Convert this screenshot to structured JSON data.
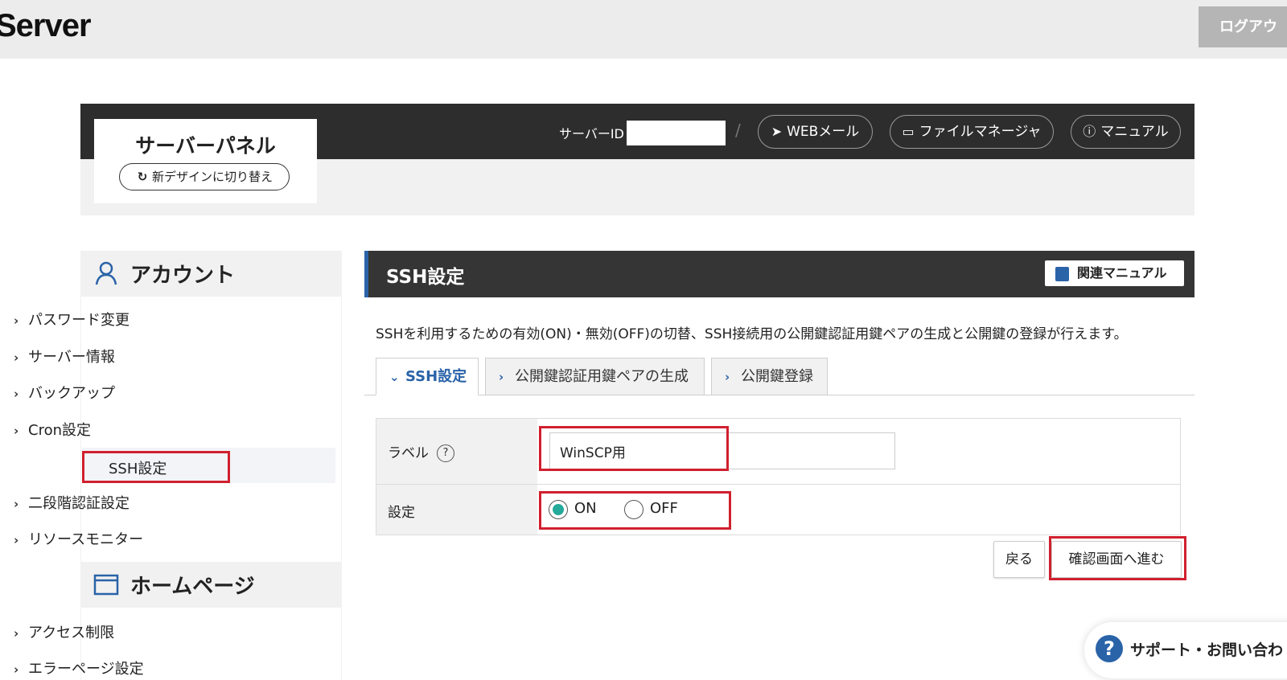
{
  "topbar": {
    "brand": "Server",
    "logout_label": "ログアウ"
  },
  "header": {
    "panel_title": "サーバーパネル",
    "design_switch_label": "新デザインに切り替え",
    "server_id_label": "サーバーID",
    "separator": "/",
    "webmail_label": "WEBメール",
    "filemanager_label": "ファイルマネージャ",
    "manual_label": "マニュアル"
  },
  "sidebar": {
    "account_title": "アカウント",
    "account_items": [
      "パスワード変更",
      "サーバー情報",
      "バックアップ",
      "Cron設定",
      "SSH設定",
      "二段階認証設定",
      "リソースモニター"
    ],
    "homepage_title": "ホームページ",
    "homepage_items": [
      "アクセス制限",
      "エラーページ設定"
    ]
  },
  "main": {
    "title": "SSH設定",
    "related_manual_label": "関連マニュアル",
    "description": "SSHを利用するための有効(ON)・無効(OFF)の切替、SSH接続用の公開鍵認証用鍵ペアの生成と公開鍵の登録が行えます。",
    "tabs": [
      {
        "label": "SSH設定",
        "active": true
      },
      {
        "label": "公開鍵認証用鍵ペアの生成",
        "active": false
      },
      {
        "label": "公開鍵登録",
        "active": false
      }
    ],
    "form": {
      "label_field_label": "ラベル",
      "help_glyph": "?",
      "label_value": "WinSCP用",
      "setting_label": "設定",
      "on_label": "ON",
      "off_label": "OFF",
      "selected": "ON"
    },
    "back_label": "戻る",
    "next_label": "確認画面へ進む"
  },
  "support": {
    "glyph": "?",
    "label": "サポート・お問い合わ"
  },
  "colors": {
    "accent": "#2a63a8",
    "radio_on": "#25a99a",
    "highlight": "#d0202e",
    "dark_bar": "#2d2d2d"
  }
}
